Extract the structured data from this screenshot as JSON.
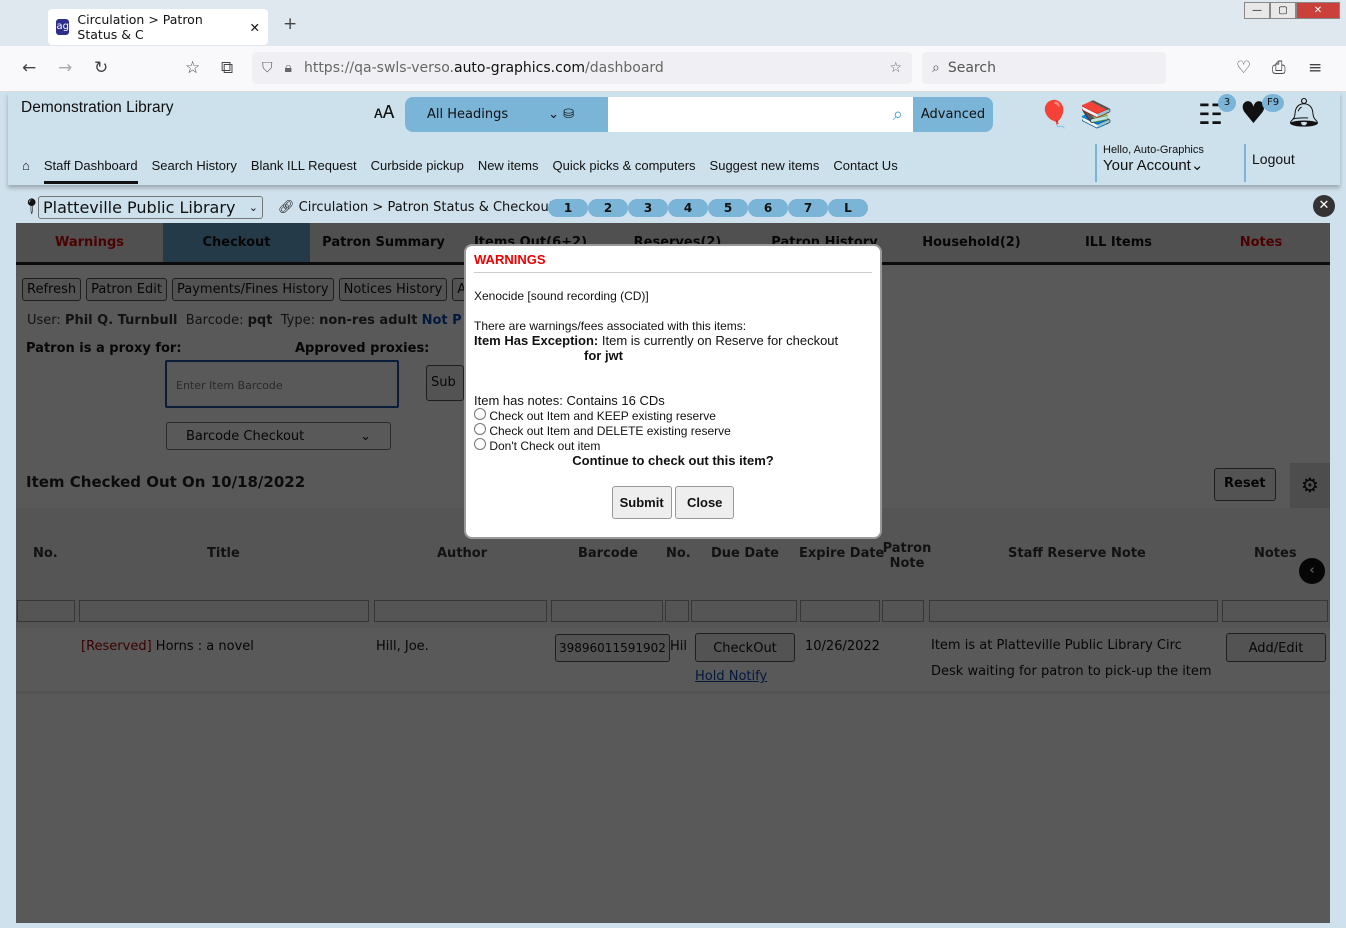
{
  "browser": {
    "tab_title": "Circulation > Patron Status & C",
    "url_prefix": "https://qa-swls-verso.",
    "url_domain": "auto-graphics.com",
    "url_path": "/dashboard",
    "search_placeholder": "Search"
  },
  "header": {
    "library": "Demonstration Library",
    "search_type": "All Headings",
    "advanced": "Advanced",
    "cart_count": "3",
    "favorites_badge": "F9",
    "greeting": "Hello, Auto-Graphics",
    "account": "Your Account",
    "logout": "Logout"
  },
  "nav": [
    "Staff Dashboard",
    "Search History",
    "Blank ILL Request",
    "Curbside pickup",
    "New items",
    "Quick picks & computers",
    "Suggest new items",
    "Contact Us"
  ],
  "location": {
    "library": "Platteville Public Library",
    "crumb1": "Circulation",
    "crumb2": "Patron Status & Checkout",
    "pills": [
      "1",
      "2",
      "3",
      "4",
      "5",
      "6",
      "7",
      "L"
    ]
  },
  "tabs": [
    "Warnings",
    "Checkout",
    "Patron Summary",
    "Items Out(6+2)",
    "Reserves(2)",
    "Patron History",
    "Household(2)",
    "ILL Items",
    "Notes"
  ],
  "actions": [
    "Refresh",
    "Patron Edit",
    "Payments/Fines History",
    "Notices History",
    "Ad"
  ],
  "patron": {
    "user_label": "User:",
    "user": "Phil Q. Turnbull",
    "barcode_label": "Barcode:",
    "barcode": "pqt",
    "type_label": "Type:",
    "type": "non-res adult",
    "link": "Not P",
    "proxy_for": "Patron is a proxy for:",
    "approved": "Approved proxies:"
  },
  "checkout": {
    "barcode_placeholder": "Enter Item Barcode",
    "submit": "Sub",
    "mode": "Barcode Checkout",
    "checked_out": "Item Checked Out On 10/18/2022",
    "reset": "Reset"
  },
  "table": {
    "headers": [
      "No.",
      "Title",
      "Author",
      "Barcode",
      "No.",
      "Due Date",
      "Expire Date",
      "Patron Note",
      "Staff Reserve Note",
      "Notes"
    ],
    "row": {
      "status": "[Reserved]",
      "title": "Horns : a novel",
      "author": "Hill, Joe.",
      "barcode": "39896011591902",
      "no": "Hil",
      "checkout": "CheckOut",
      "hold_notify": "Hold Notify",
      "expire": "10/26/2022",
      "staff_note": "Item is at Platteville Public Library Circ Desk waiting for patron to pick-up the item",
      "notes_btn": "Add/Edit"
    }
  },
  "modal": {
    "title": "WARNINGS",
    "item": "Xenocide [sound recording (CD)]",
    "warn": "There are warnings/fees associated with this items:",
    "exc_label": "Item Has Exception:",
    "exc": "Item is currently on Reserve for checkout",
    "exc2": "for jwt",
    "notes": "Item has notes: Contains 16 CDs",
    "options": [
      "Check out Item and KEEP existing reserve",
      "Check out Item and DELETE existing reserve",
      "Don't Check out item"
    ],
    "question": "Continue to check out this item?",
    "submit": "Submit",
    "close": "Close"
  }
}
